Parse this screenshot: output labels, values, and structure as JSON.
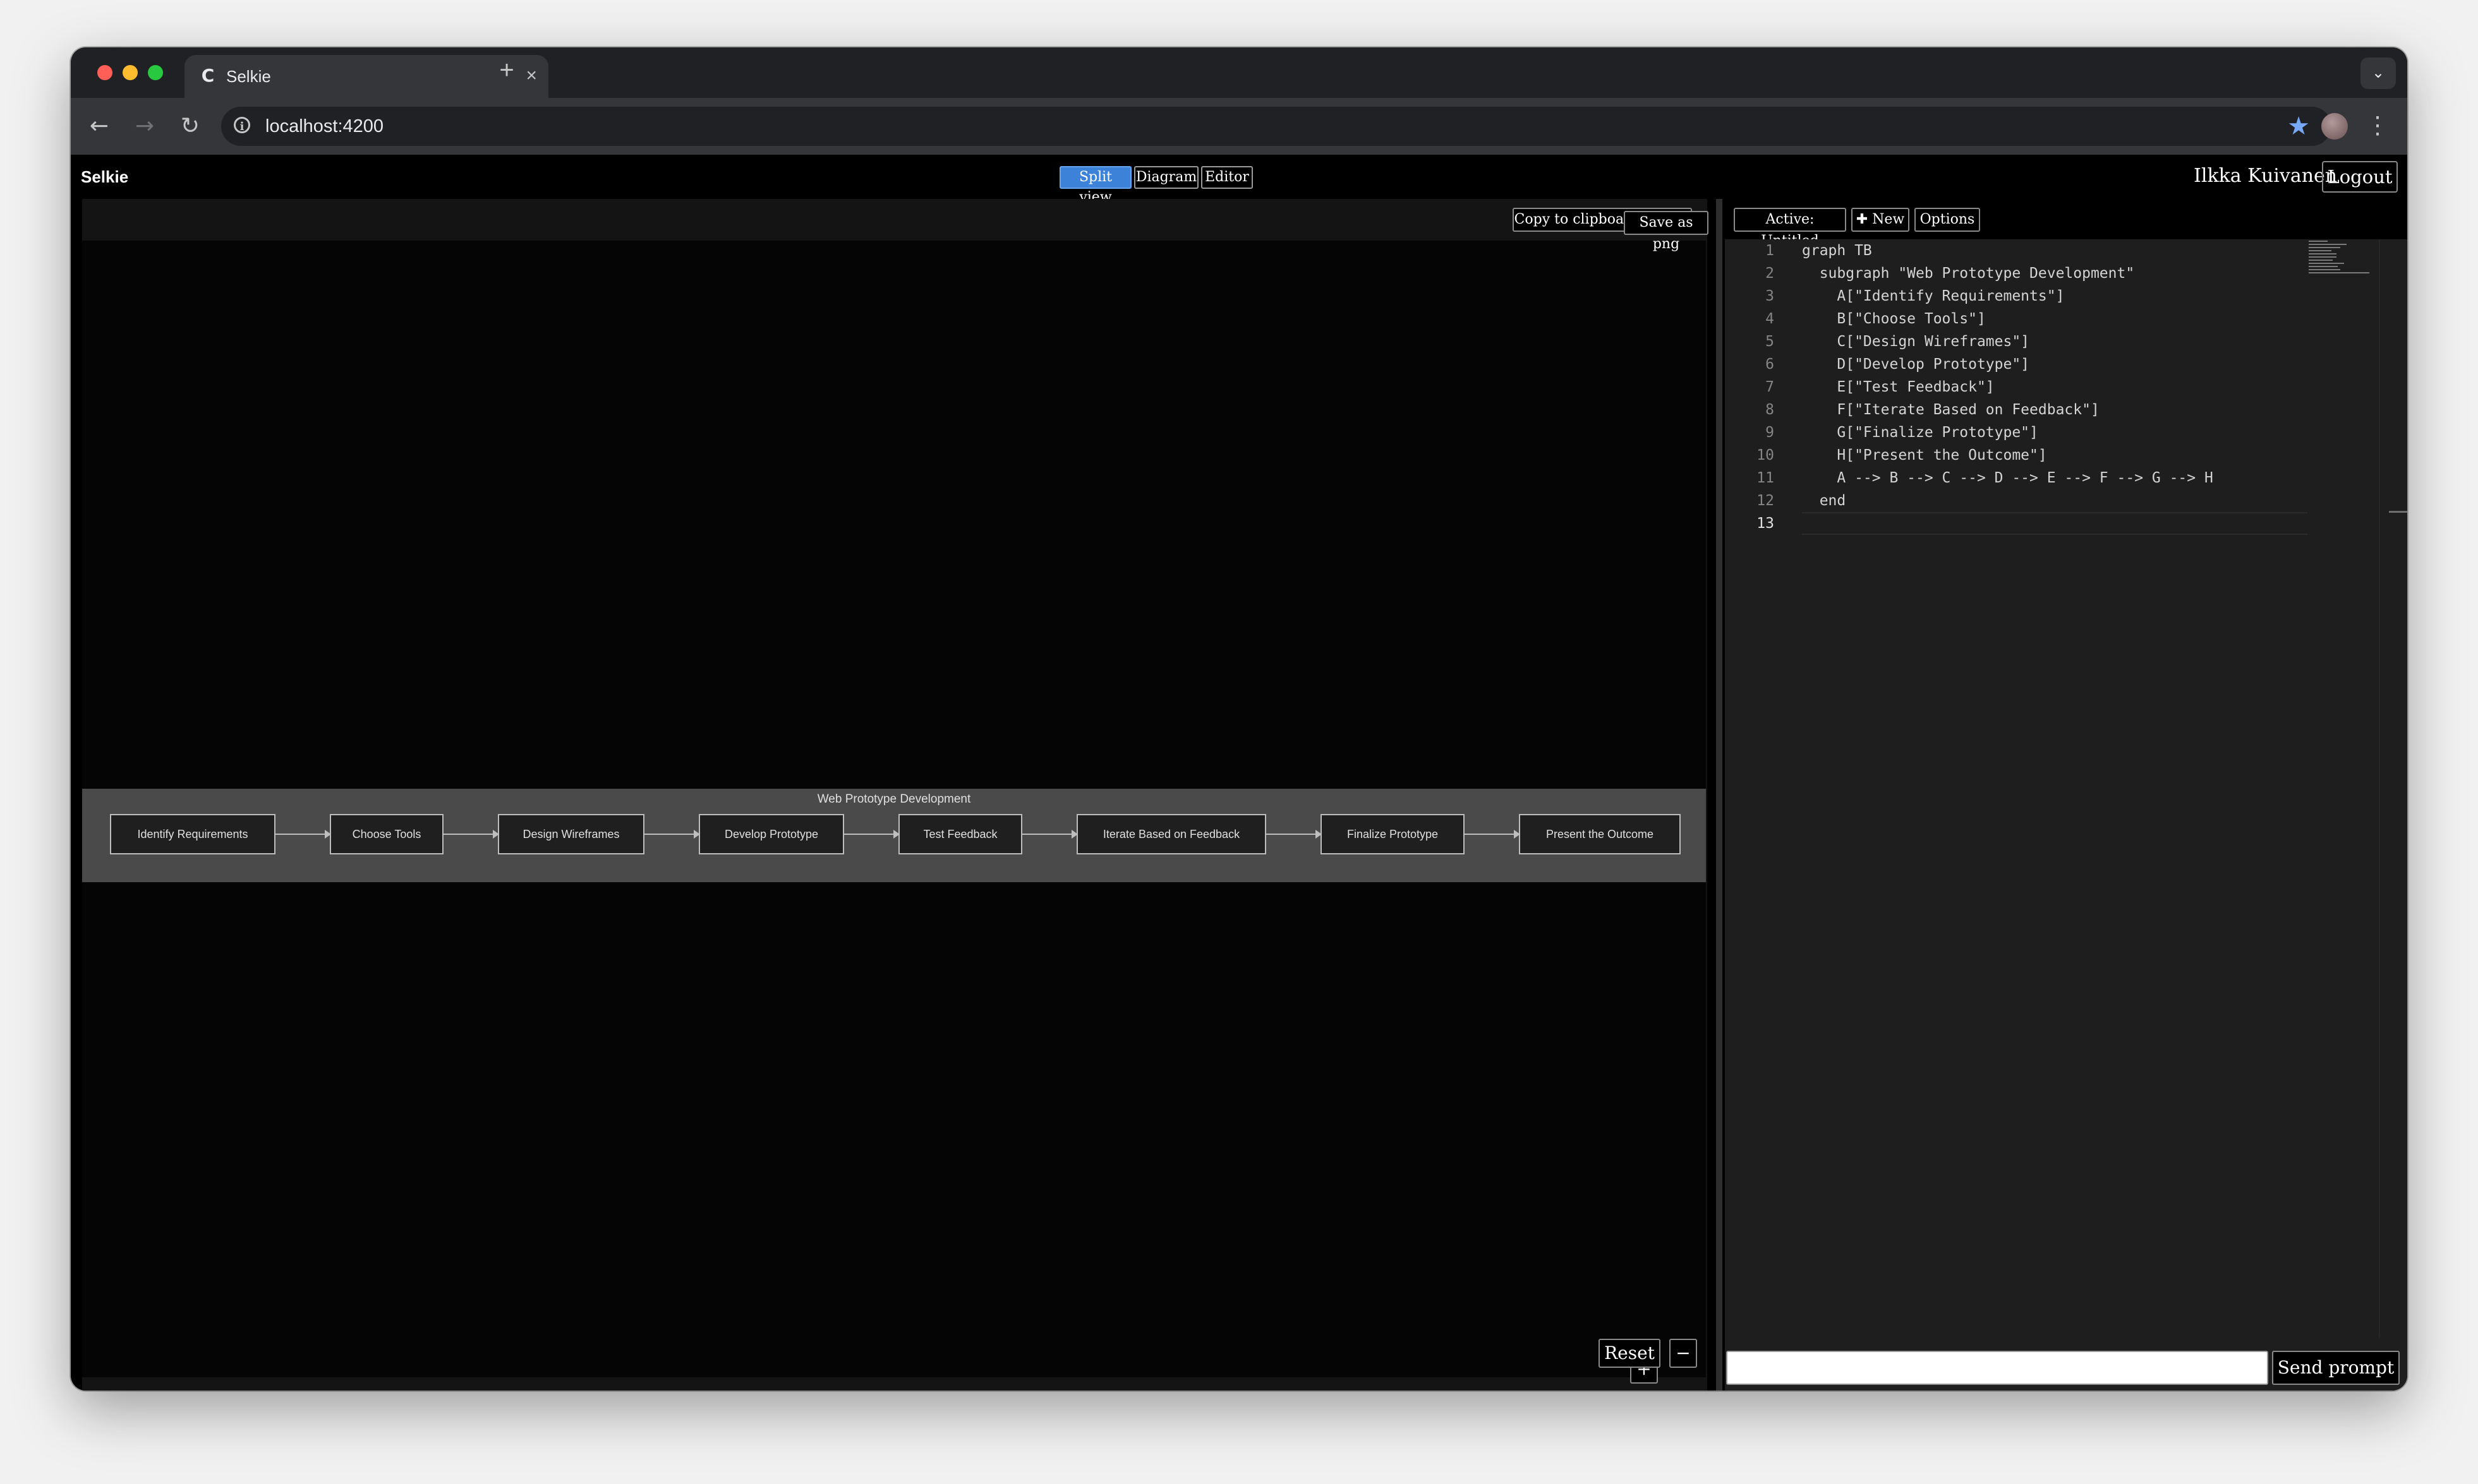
{
  "browser": {
    "tab_title": "Selkie",
    "tab_favicon": "C",
    "url": "localhost:4200",
    "new_tab_glyph": "+",
    "close_glyph": "×"
  },
  "app": {
    "brand": "Selkie",
    "views": [
      "Split view",
      "Diagram",
      "Editor"
    ],
    "active_view": "Split view",
    "user_name": "Ilkka Kuivanen",
    "logout_label": "Logout"
  },
  "diagram": {
    "copy_label": "Copy to clipboard as png",
    "save_label": "Save as png",
    "subgraph_title": "Web Prototype Development",
    "nodes": [
      "Identify Requirements",
      "Choose Tools",
      "Design Wireframes",
      "Develop Prototype",
      "Test Feedback",
      "Iterate Based on Feedback",
      "Finalize Prototype",
      "Present the Outcome"
    ],
    "zoom_in": "+",
    "reset": "Reset",
    "zoom_out": "−"
  },
  "editor": {
    "active_label": "Active: Untitled",
    "new_label": "New",
    "options_label": "Options",
    "lines": [
      "graph TB",
      "  subgraph \"Web Prototype Development\"",
      "    A[\"Identify Requirements\"]",
      "    B[\"Choose Tools\"]",
      "    C[\"Design Wireframes\"]",
      "    D[\"Develop Prototype\"]",
      "    E[\"Test Feedback\"]",
      "    F[\"Iterate Based on Feedback\"]",
      "    G[\"Finalize Prototype\"]",
      "    H[\"Present the Outcome\"]",
      "    A --> B --> C --> D --> E --> F --> G --> H",
      "  end",
      ""
    ],
    "current_line": 13,
    "prompt_value": "",
    "send_label": "Send prompt"
  },
  "colors": {
    "accent": "#3b82d8",
    "bookmark_star": "#78a9f7"
  }
}
